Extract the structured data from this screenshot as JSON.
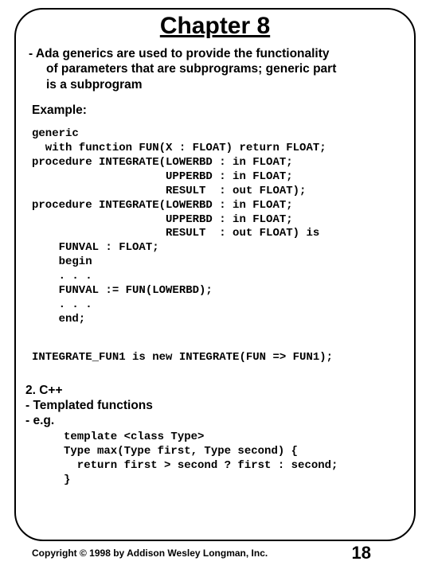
{
  "title": "Chapter 8",
  "bullet": {
    "line1": "- Ada generics are used to provide the functionality",
    "line2": "of parameters that are subprograms; generic part",
    "line3": "is a subprogram"
  },
  "example_label": "Example:",
  "code_block1": "generic\n  with function FUN(X : FLOAT) return FLOAT;\nprocedure INTEGRATE(LOWERBD : in FLOAT;\n                    UPPERBD : in FLOAT;\n                    RESULT  : out FLOAT);\nprocedure INTEGRATE(LOWERBD : in FLOAT;\n                    UPPERBD : in FLOAT;\n                    RESULT  : out FLOAT) is\n    FUNVAL : FLOAT;\n    begin\n    . . .\n    FUNVAL := FUN(LOWERBD);\n    . . .\n    end;",
  "code_block2": "INTEGRATE_FUN1 is new INTEGRATE(FUN => FUN1);",
  "section2": {
    "line1": "2. C++",
    "line2": "  - Templated functions",
    "line3": "  - e.g."
  },
  "code_block3": "template <class Type>\nType max(Type first, Type second) {\n  return first > second ? first : second;\n}",
  "copyright": "Copyright © 1998 by Addison Wesley Longman, Inc.",
  "page_number": "18"
}
